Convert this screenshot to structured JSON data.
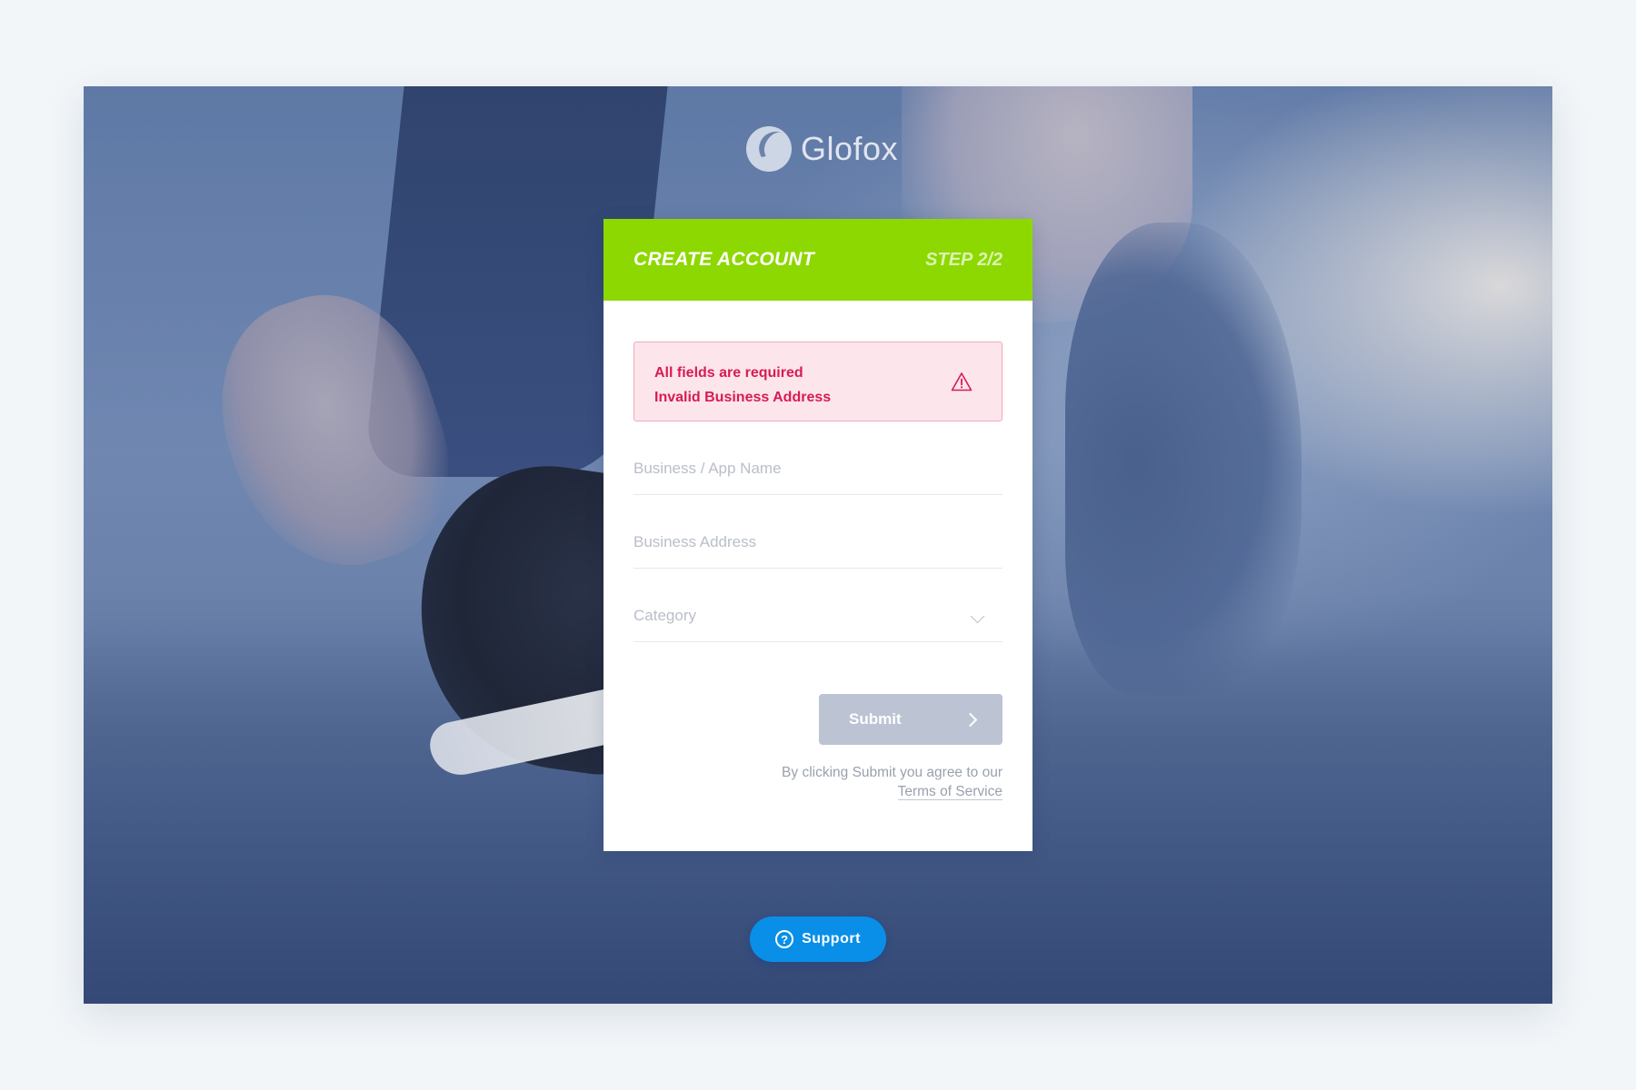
{
  "brand": {
    "name": "Glofox",
    "logo_icon": "glofox-logo-icon"
  },
  "card": {
    "title": "CREATE ACCOUNT",
    "step": "STEP 2/2",
    "header_color": "#8dd800"
  },
  "alert": {
    "lines": [
      "All fields are required",
      "Invalid Business Address"
    ],
    "icon": "warning-triangle-icon",
    "color": "#d81b54",
    "background": "#fde6eb"
  },
  "form": {
    "business_name": {
      "value": "",
      "placeholder": "Business / App Name"
    },
    "business_address": {
      "value": "",
      "placeholder": "Business Address"
    },
    "category": {
      "selected": "Category",
      "icon": "chevron-down-icon"
    }
  },
  "submit": {
    "label": "Submit",
    "icon": "chevron-right-icon",
    "color": "#bcc3d3"
  },
  "terms": {
    "text": "By clicking Submit you agree to our",
    "link_label": "Terms of Service"
  },
  "support": {
    "label": "Support",
    "icon": "help-circle-icon",
    "icon_glyph": "?",
    "color": "#0a8fe8"
  }
}
